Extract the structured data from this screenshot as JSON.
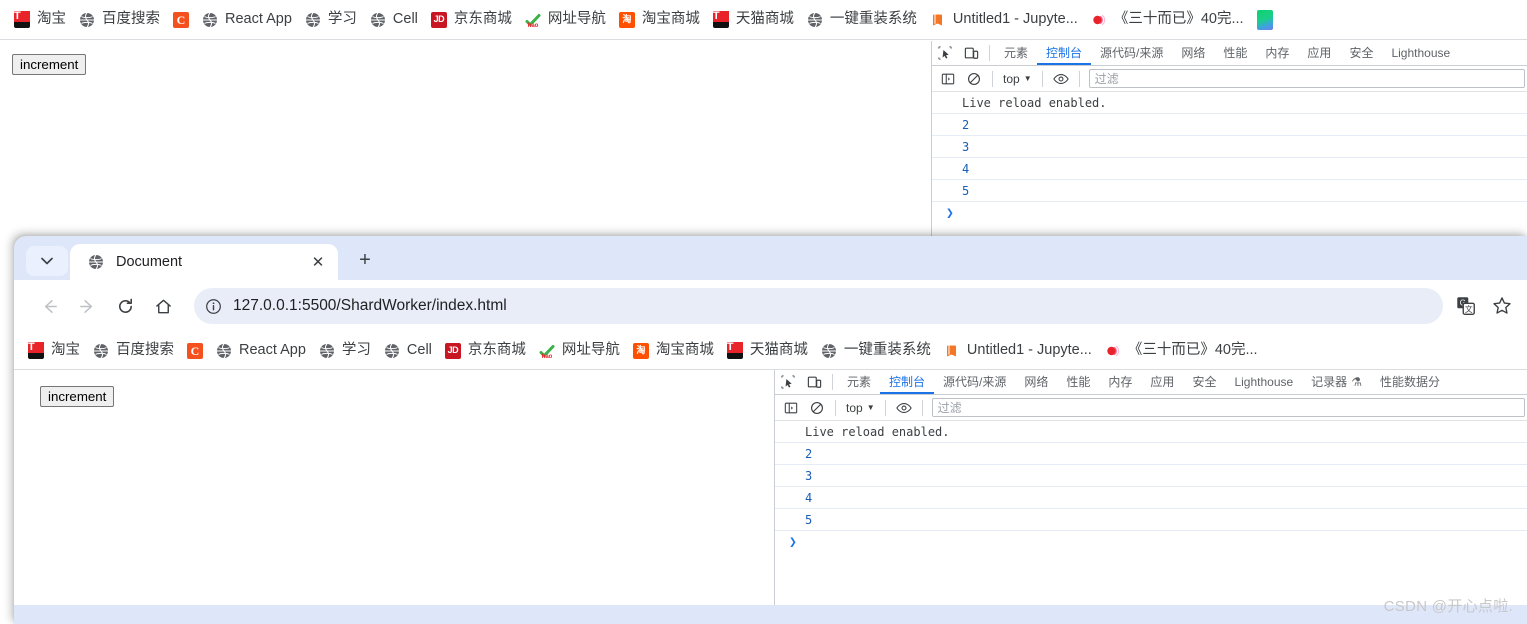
{
  "bookmarks_top": [
    {
      "label": "淘宝",
      "icon": "taobao-icon"
    },
    {
      "label": "百度搜索",
      "icon": "globe-icon"
    },
    {
      "label": "",
      "icon": "coursera-c-icon"
    },
    {
      "label": "React App",
      "icon": "globe-icon"
    },
    {
      "label": "学习",
      "icon": "globe-icon"
    },
    {
      "label": "Cell",
      "icon": "globe-icon"
    },
    {
      "label": "京东商城",
      "icon": "jd-icon"
    },
    {
      "label": "网址导航",
      "icon": "hao123-icon"
    },
    {
      "label": "淘宝商城",
      "icon": "taobao-orange-icon"
    },
    {
      "label": "天猫商城",
      "icon": "tmall-icon"
    },
    {
      "label": "一键重装系统",
      "icon": "globe-icon"
    },
    {
      "label": "Untitled1 - Jupyte...",
      "icon": "jupyter-book-icon"
    },
    {
      "label": "《三十而已》40完...",
      "icon": "video-icon"
    },
    {
      "label": "",
      "icon": "gradient-app-icon"
    }
  ],
  "bookmarks_front": [
    {
      "label": "淘宝",
      "icon": "taobao-icon"
    },
    {
      "label": "百度搜索",
      "icon": "globe-icon"
    },
    {
      "label": "",
      "icon": "coursera-c-icon"
    },
    {
      "label": "React App",
      "icon": "globe-icon"
    },
    {
      "label": "学习",
      "icon": "globe-icon"
    },
    {
      "label": "Cell",
      "icon": "globe-icon"
    },
    {
      "label": "京东商城",
      "icon": "jd-icon"
    },
    {
      "label": "网址导航",
      "icon": "hao123-icon"
    },
    {
      "label": "淘宝商城",
      "icon": "taobao-orange-icon"
    },
    {
      "label": "天猫商城",
      "icon": "tmall-icon"
    },
    {
      "label": "一键重装系统",
      "icon": "globe-icon"
    },
    {
      "label": "Untitled1 - Jupyte...",
      "icon": "jupyter-book-icon"
    },
    {
      "label": "《三十而已》40完...",
      "icon": "video-icon"
    }
  ],
  "top_window": {
    "page": {
      "increment_button": "increment"
    },
    "devtools": {
      "tabs": [
        {
          "label": "元素",
          "active": false
        },
        {
          "label": "控制台",
          "active": true
        },
        {
          "label": "源代码/来源",
          "active": false
        },
        {
          "label": "网络",
          "active": false
        },
        {
          "label": "性能",
          "active": false
        },
        {
          "label": "内存",
          "active": false
        },
        {
          "label": "应用",
          "active": false
        },
        {
          "label": "安全",
          "active": false
        },
        {
          "label": "Lighthouse",
          "active": false
        }
      ],
      "toolbar": {
        "context": "top",
        "filter_placeholder": "过滤"
      },
      "console": {
        "entries": [
          {
            "text": "Live reload enabled.",
            "kind": "msg"
          },
          {
            "text": "2",
            "kind": "num"
          },
          {
            "text": "3",
            "kind": "num"
          },
          {
            "text": "4",
            "kind": "num"
          },
          {
            "text": "5",
            "kind": "num"
          }
        ],
        "prompt": "❯"
      }
    }
  },
  "front_window": {
    "tab": {
      "title": "Document",
      "close_label": "✕"
    },
    "new_tab_label": "+",
    "tab_search_label": "⌄",
    "omnibox": {
      "url": "127.0.0.1:5500/ShardWorker/index.html"
    },
    "page": {
      "increment_button": "increment"
    },
    "devtools": {
      "tabs": [
        {
          "label": "元素",
          "active": false
        },
        {
          "label": "控制台",
          "active": true
        },
        {
          "label": "源代码/来源",
          "active": false
        },
        {
          "label": "网络",
          "active": false
        },
        {
          "label": "性能",
          "active": false
        },
        {
          "label": "内存",
          "active": false
        },
        {
          "label": "应用",
          "active": false
        },
        {
          "label": "安全",
          "active": false
        },
        {
          "label": "Lighthouse",
          "active": false
        },
        {
          "label": "记录器",
          "active": false
        },
        {
          "label": "性能数据分",
          "active": false
        }
      ],
      "toolbar": {
        "context": "top",
        "filter_placeholder": "过滤"
      },
      "console": {
        "entries": [
          {
            "text": "Live reload enabled.",
            "kind": "msg"
          },
          {
            "text": "2",
            "kind": "num"
          },
          {
            "text": "3",
            "kind": "num"
          },
          {
            "text": "4",
            "kind": "num"
          },
          {
            "text": "5",
            "kind": "num"
          }
        ],
        "prompt": "❯"
      }
    }
  },
  "watermark": "CSDN @开心点啦.",
  "colors": {
    "accent": "#1a73e8",
    "tabstrip_bg": "#dee6fa",
    "omnibox_bg": "#e9edf8"
  }
}
